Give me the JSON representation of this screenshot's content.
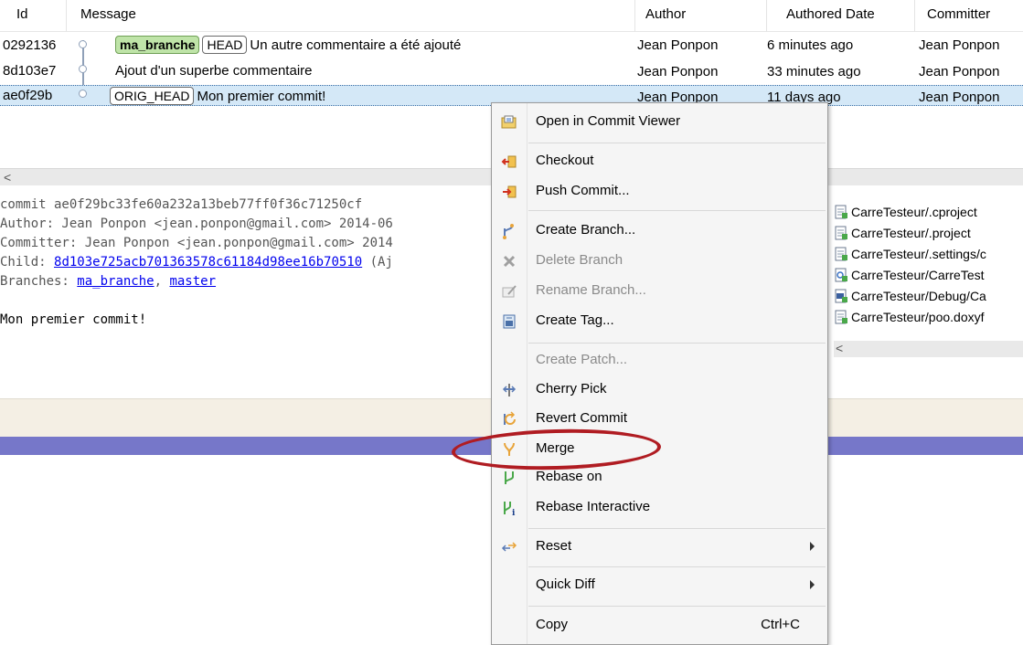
{
  "table": {
    "columns": {
      "id": "Id",
      "message": "Message",
      "author": "Author",
      "date": "Authored Date",
      "committer": "Committer"
    },
    "rows": [
      {
        "id": "0292136",
        "refs": [
          {
            "label": "ma_branche",
            "type": "branch"
          },
          {
            "label": "HEAD",
            "type": "tag"
          }
        ],
        "message": "Un autre commentaire a été ajouté",
        "author": "Jean Ponpon",
        "date": "6 minutes ago",
        "committer": "Jean Ponpon"
      },
      {
        "id": "8d103e7",
        "refs": [],
        "message": "Ajout d'un superbe commentaire",
        "author": "Jean Ponpon",
        "date": "33 minutes ago",
        "committer": "Jean Ponpon"
      },
      {
        "id": "ae0f29b",
        "refs": [
          {
            "label": "ORIG_HEAD",
            "type": "tag"
          }
        ],
        "message": "Mon premier commit!",
        "author": "Jean Ponpon",
        "date": "11 days ago",
        "committer": "Jean Ponpon"
      }
    ]
  },
  "details": {
    "commit": "commit ae0f29bc33fe60a232a13beb77ff0f36c71250cf",
    "author": "Author: Jean Ponpon <jean.ponpon@gmail.com> 2014-06",
    "committer": "Committer: Jean Ponpon <jean.ponpon@gmail.com> 2014",
    "child_prefix": "Child: ",
    "child_hash": "8d103e725acb701363578c61184d98ee16b70510",
    "child_suffix": " (Aj",
    "branches_prefix": "Branches: ",
    "branch_1": "ma_branche",
    "branch_sep": ", ",
    "branch_2": "master",
    "message": "Mon premier commit!"
  },
  "files": [
    "CarreTesteur/.cproject",
    "CarreTesteur/.project",
    "CarreTesteur/.settings/c",
    "CarreTesteur/CarreTest",
    "CarreTesteur/Debug/Ca",
    "CarreTesteur/poo.doxyf"
  ],
  "menu": {
    "open_commit_viewer": "Open in Commit Viewer",
    "checkout": "Checkout",
    "push_commit": "Push Commit...",
    "create_branch": "Create Branch...",
    "delete_branch": "Delete Branch",
    "rename_branch": "Rename Branch...",
    "create_tag": "Create Tag...",
    "create_patch": "Create Patch...",
    "cherry_pick": "Cherry Pick",
    "revert_commit": "Revert Commit",
    "merge": "Merge",
    "rebase_on": "Rebase on",
    "rebase_interactive": "Rebase Interactive",
    "reset": "Reset",
    "quick_diff": "Quick Diff",
    "copy": "Copy",
    "copy_shortcut": "Ctrl+C"
  },
  "colors": {
    "highlight_ring": "#b01c22",
    "selection": "#d4e8f7",
    "branch_ref": "#bfe4a8",
    "purple_bar": "#7677c9"
  }
}
